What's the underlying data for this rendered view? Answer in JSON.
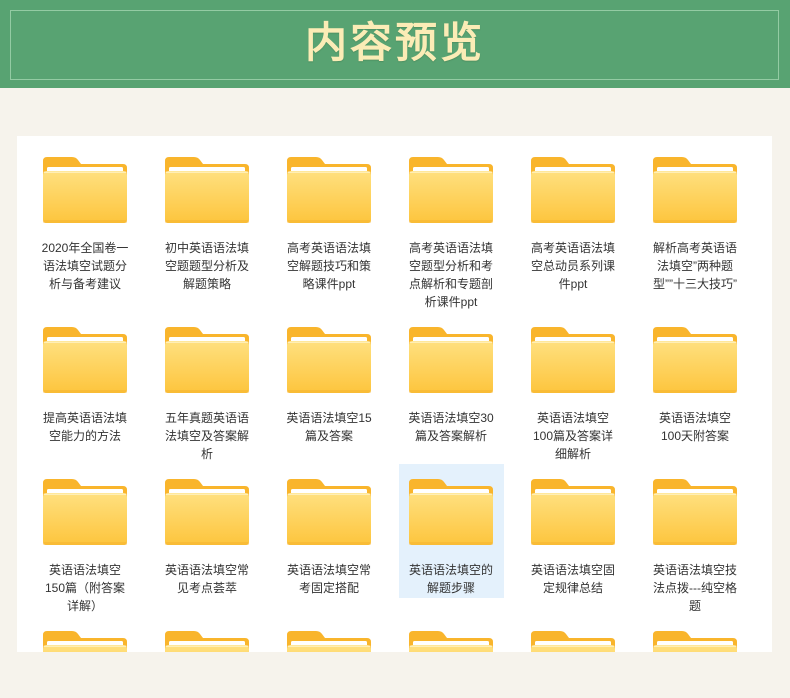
{
  "banner": {
    "title": "内容预览"
  },
  "colors": {
    "banner_bg": "#58a372",
    "banner_title": "#fbecb6",
    "page_bg": "#f6f3ec",
    "panel_bg": "#ffffff",
    "selected_bg": "#e4f1fc",
    "folder_back": "#f9b52c",
    "folder_front_top": "#ffe07f",
    "folder_front_bottom": "#fdc53d"
  },
  "selected_index": 15,
  "files": [
    {
      "icon": "folder-icon",
      "label": [
        "2020年全国卷一",
        "语法填空试题分",
        "析与备考建议"
      ]
    },
    {
      "icon": "folder-icon",
      "label": [
        "初中英语语法填",
        "空题题型分析及",
        "解题策略"
      ]
    },
    {
      "icon": "folder-icon",
      "label": [
        "高考英语语法填",
        "空解题技巧和策",
        "略课件ppt"
      ]
    },
    {
      "icon": "folder-icon",
      "label": [
        "高考英语语法填",
        "空题型分析和考",
        "点解析和专题剖",
        "析课件ppt"
      ]
    },
    {
      "icon": "folder-icon",
      "label": [
        "高考英语语法填",
        "空总动员系列课",
        "件ppt"
      ]
    },
    {
      "icon": "folder-icon",
      "label": [
        "解析高考英语语",
        "法填空”两种题",
        "型””十三大技巧”"
      ]
    },
    {
      "icon": "folder-icon",
      "label": [
        "提高英语语法填",
        "空能力的方法"
      ]
    },
    {
      "icon": "folder-icon",
      "label": [
        "五年真题英语语",
        "法填空及答案解",
        "析"
      ]
    },
    {
      "icon": "folder-icon",
      "label": [
        "英语语法填空15",
        "篇及答案"
      ]
    },
    {
      "icon": "folder-icon",
      "label": [
        "英语语法填空30",
        "篇及答案解析"
      ]
    },
    {
      "icon": "folder-icon",
      "label": [
        "英语语法填空",
        "100篇及答案详",
        "细解析"
      ]
    },
    {
      "icon": "folder-icon",
      "label": [
        "英语语法填空",
        "100天附答案"
      ]
    },
    {
      "icon": "folder-icon",
      "label": [
        "英语语法填空",
        "150篇（附答案",
        "详解）"
      ]
    },
    {
      "icon": "folder-icon",
      "label": [
        "英语语法填空常",
        "见考点荟萃"
      ]
    },
    {
      "icon": "folder-icon",
      "label": [
        "英语语法填空常",
        "考固定搭配"
      ]
    },
    {
      "icon": "folder-icon",
      "label": [
        "英语语法填空的",
        "解题步骤"
      ]
    },
    {
      "icon": "folder-icon",
      "label": [
        "英语语法填空固",
        "定规律总结"
      ]
    },
    {
      "icon": "folder-icon",
      "label": [
        "英语语法填空技",
        "法点拨---纯空格",
        "题"
      ]
    },
    {
      "icon": "folder-icon",
      "label": []
    },
    {
      "icon": "folder-icon",
      "label": []
    },
    {
      "icon": "folder-icon",
      "label": []
    },
    {
      "icon": "folder-icon",
      "label": []
    },
    {
      "icon": "folder-icon",
      "label": []
    },
    {
      "icon": "folder-icon",
      "label": []
    }
  ]
}
